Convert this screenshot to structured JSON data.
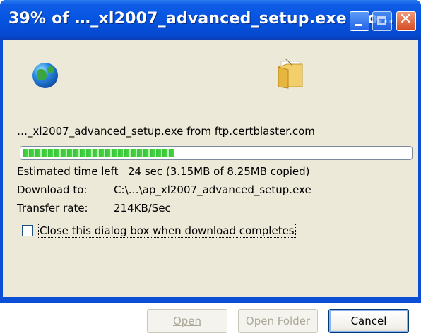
{
  "window": {
    "title": "39% of …_xl2007_advanced_setup.exe fro…",
    "controls": {
      "minimize_icon": "minimize-icon",
      "maximize_icon": "maximize-icon",
      "close_icon": "close-icon",
      "close_glyph": "✕"
    }
  },
  "download": {
    "progress_percent": 39,
    "source_line": "…_xl2007_advanced_setup.exe from ftp.certblaster.com",
    "estimated_label": "Estimated time left",
    "estimated_value": "24 sec (3.15MB of 8.25MB copied)",
    "download_to_label": "Download to:",
    "download_to_value": "C:\\…\\ap_xl2007_advanced_setup.exe",
    "transfer_rate_label": "Transfer rate:",
    "transfer_rate_value": "214KB/Sec",
    "close_when_done_label": "Close this dialog box when download completes",
    "close_when_done_checked": false
  },
  "buttons": {
    "open_label": "Open",
    "open_folder_label": "Open Folder",
    "cancel_label": "Cancel"
  },
  "icons": {
    "source": "globe-icon",
    "destination": "folder-icon"
  },
  "colors": {
    "titlebar": "#0554e0",
    "progress": "#37c436",
    "dialog_bg": "#ece9d8"
  }
}
